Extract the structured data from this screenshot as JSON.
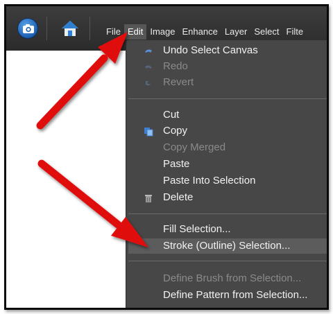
{
  "toolbar": {
    "icons": [
      "camera-icon",
      "home-icon"
    ],
    "menu": [
      "File",
      "Edit",
      "Image",
      "Enhance",
      "Layer",
      "Select",
      "Filte"
    ],
    "active_menu": "Edit"
  },
  "edit_menu": {
    "undo": "Undo Select Canvas",
    "redo": "Redo",
    "revert": "Revert",
    "cut": "Cut",
    "copy": "Copy",
    "copy_merged": "Copy Merged",
    "paste": "Paste",
    "paste_into": "Paste Into Selection",
    "delete": "Delete",
    "fill": "Fill Selection...",
    "stroke": "Stroke (Outline) Selection...",
    "define_brush": "Define Brush from Selection...",
    "define_pattern": "Define Pattern from Selection..."
  },
  "colors": {
    "menubar": "#333333",
    "dropdown": "#474747",
    "highlight": "#5c5c5c",
    "arrow": "#e01010",
    "accent_icon": "#1c5fb3"
  }
}
